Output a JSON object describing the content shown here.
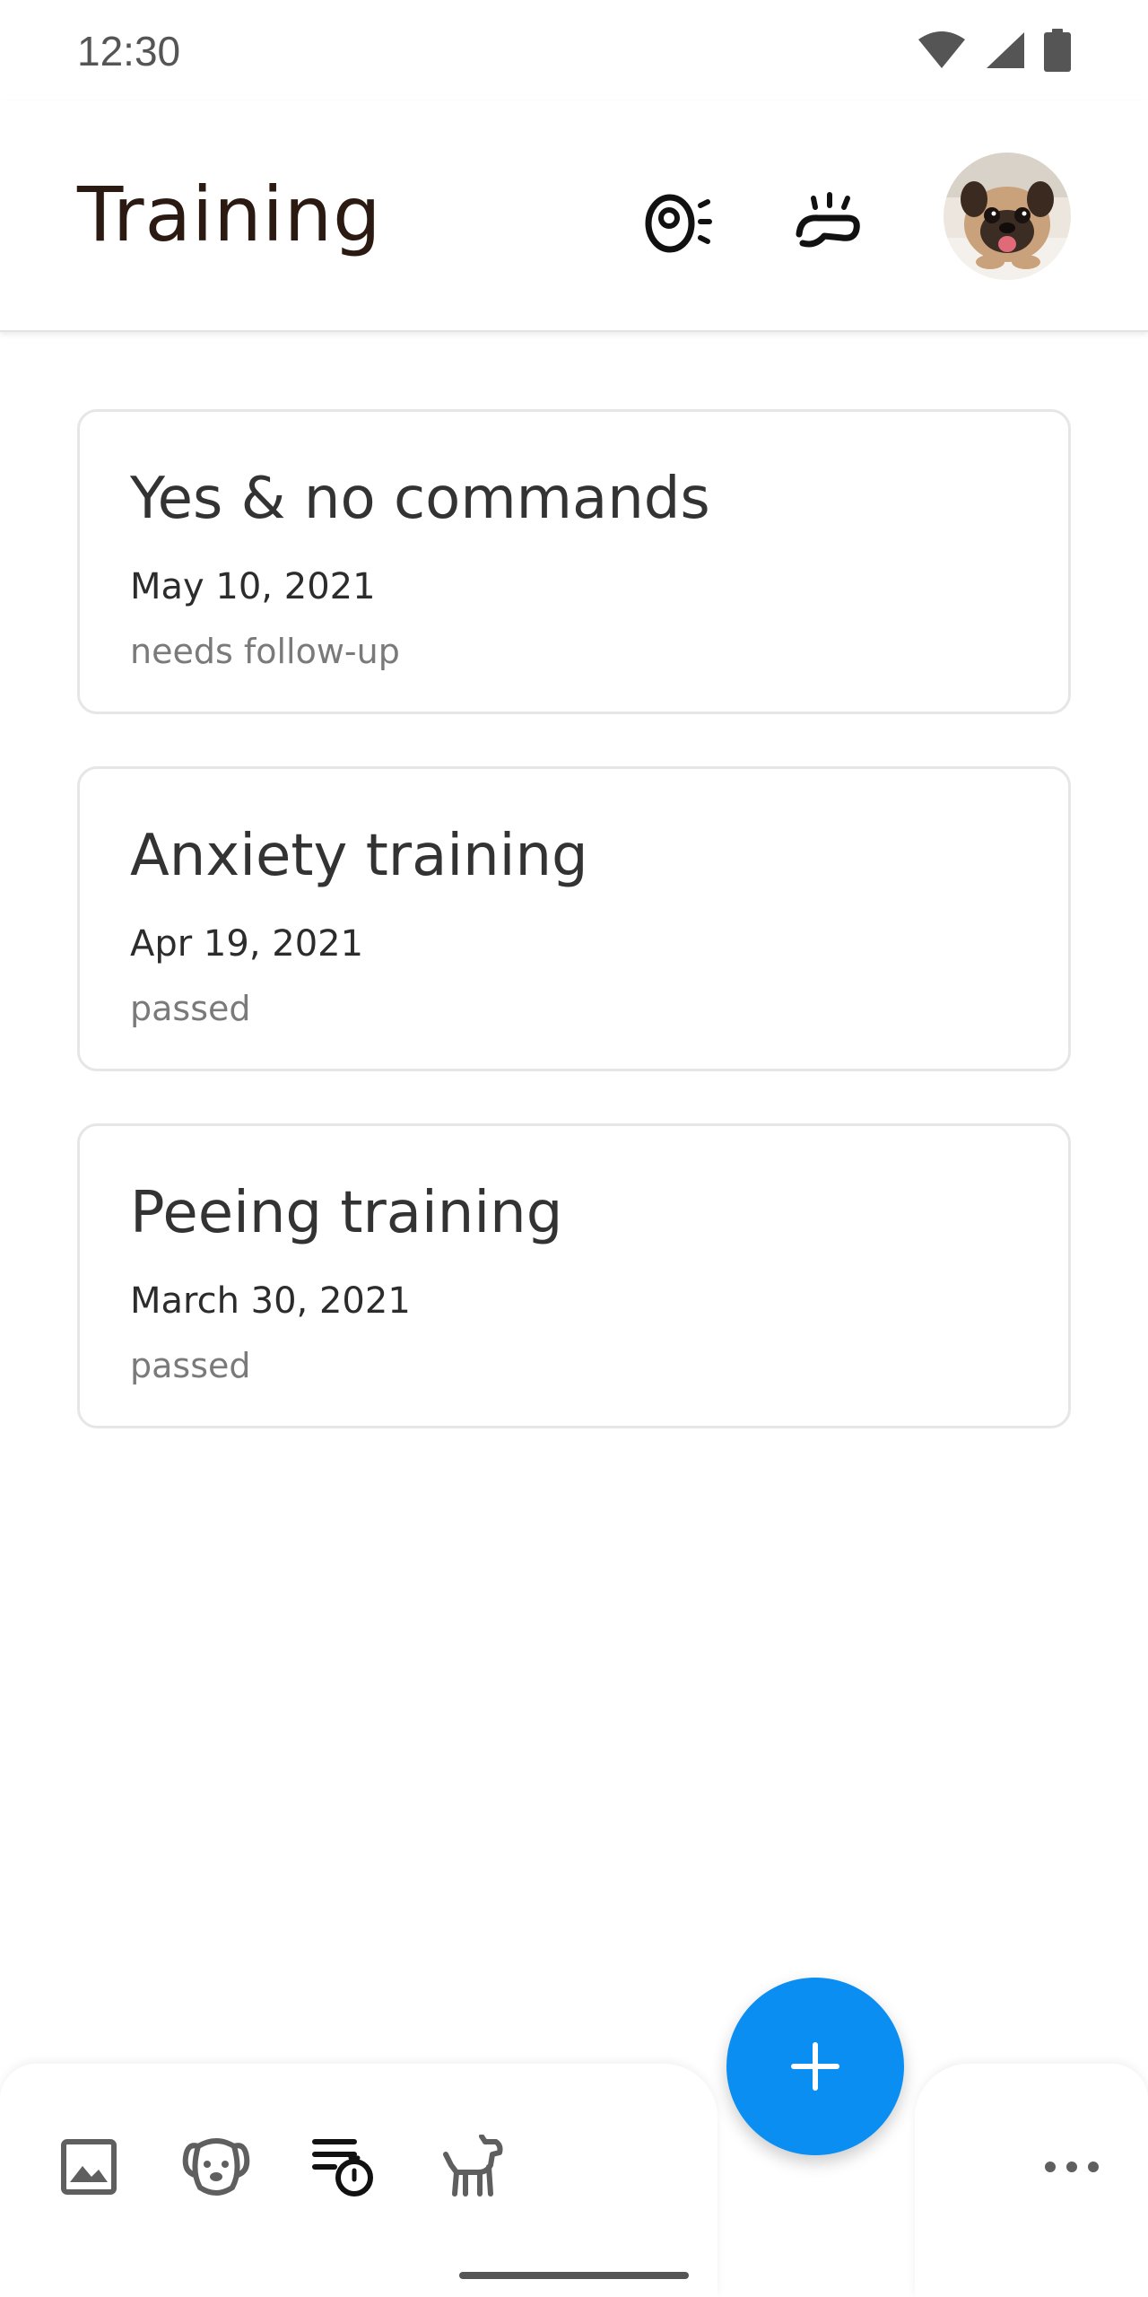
{
  "status_bar": {
    "time": "12:30",
    "icons": [
      "wifi-icon",
      "signal-icon",
      "battery-icon"
    ]
  },
  "app_bar": {
    "title": "Training",
    "actions": [
      "dog-whistle-icon",
      "dog-treat-icon"
    ],
    "avatar": "pug-avatar"
  },
  "cards": [
    {
      "title": "Yes & no commands",
      "date": "May 10, 2021",
      "status": "needs follow-up"
    },
    {
      "title": "Anxiety training",
      "date": "Apr 19, 2021",
      "status": "passed"
    },
    {
      "title": "Peeing training",
      "date": "March 30, 2021",
      "status": "passed"
    }
  ],
  "bottom_nav": {
    "items": [
      "gallery-icon",
      "dog-face-icon",
      "training-schedule-icon",
      "dog-icon"
    ],
    "active": "training-schedule-icon",
    "more": "more-horizontal-icon"
  },
  "fab": {
    "icon": "plus-icon"
  },
  "colors": {
    "accent": "#0a8ef2",
    "title_text": "#2b1a12",
    "secondary_text": "#7a7a7a"
  }
}
